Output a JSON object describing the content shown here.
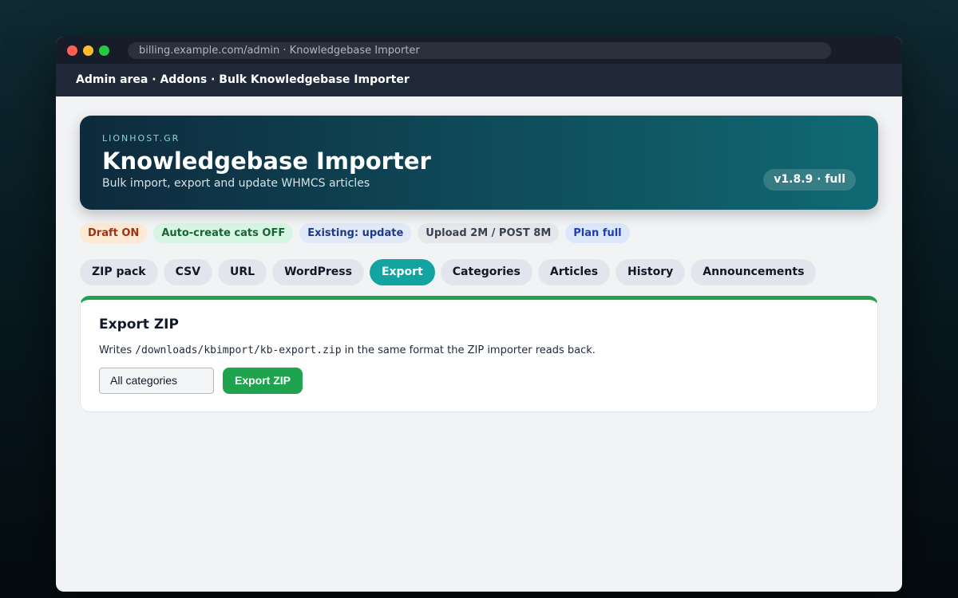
{
  "browser": {
    "url": "billing.example.com/admin · Knowledgebase Importer"
  },
  "admin_bar": {
    "breadcrumb": "Admin area · Addons · Bulk Knowledgebase Importer"
  },
  "hero": {
    "brand": "LIONHOST.GR",
    "title": "Knowledgebase Importer",
    "subtitle": "Bulk import, export and update WHMCS articles",
    "version": "v1.8.9 · full"
  },
  "status_chips": [
    {
      "label": "Draft ON"
    },
    {
      "label": "Auto-create cats OFF"
    },
    {
      "label": "Existing: update"
    },
    {
      "label": "Upload 2M / POST 8M"
    },
    {
      "label": "Plan full"
    }
  ],
  "tabs": [
    {
      "label": "ZIP pack"
    },
    {
      "label": "CSV"
    },
    {
      "label": "URL"
    },
    {
      "label": "WordPress"
    },
    {
      "label": "Export",
      "active": true
    },
    {
      "label": "Categories"
    },
    {
      "label": "Articles"
    },
    {
      "label": "History"
    },
    {
      "label": "Announcements"
    }
  ],
  "export_panel": {
    "title": "Export ZIP",
    "desc_prefix": "Writes ",
    "desc_path": "/downloads/kbimport/kb-export.zip",
    "desc_suffix": " in the same format the ZIP importer reads back.",
    "category_select": {
      "selected": "All categories"
    },
    "export_button": "Export ZIP"
  },
  "colors": {
    "accent": "#13a3a0",
    "success": "#1fa34f",
    "admin_bar": "#202938"
  },
  "icons": {
    "select_caret": "chevron-down-icon"
  }
}
